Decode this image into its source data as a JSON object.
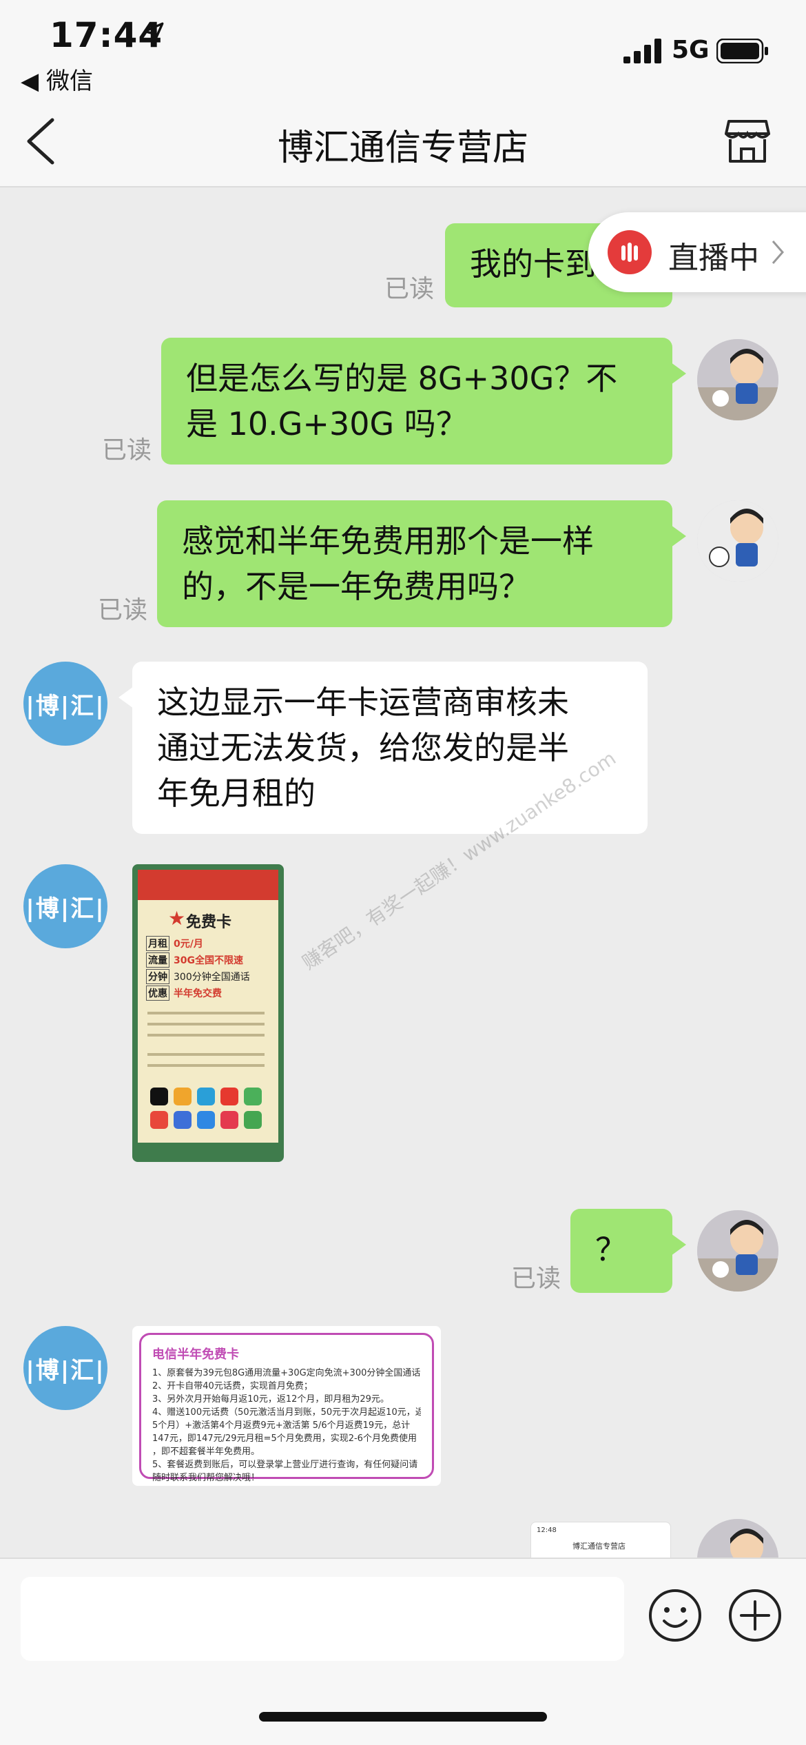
{
  "status_bar": {
    "time": "17:44",
    "back_app": "◀ 微信",
    "network": "5G"
  },
  "nav": {
    "title": "博汇通信专营店"
  },
  "live": {
    "label": "直播中"
  },
  "messages": [
    {
      "from": "me",
      "text": "我的卡到",
      "status": "已读"
    },
    {
      "from": "me",
      "lines": [
        "但是怎么写的是 8G+30G？不",
        "是 10.G+30G 吗？"
      ],
      "status": "已读"
    },
    {
      "from": "me",
      "lines": [
        "感觉和半年免费用那个是一样",
        "的，不是一年免费用吗？"
      ],
      "status": "已读"
    },
    {
      "from": "shop",
      "lines": [
        "这边显示一年卡运营商审核未",
        "通过无法发货，给您发的是半",
        "年免月租的"
      ]
    },
    {
      "from": "me",
      "text": "？",
      "status": "已读"
    }
  ],
  "shop_avatar": "|博|汇|",
  "poster": {
    "title": "免费卡",
    "rows": [
      {
        "k": "月租",
        "v": "0元/月"
      },
      {
        "k": "流量",
        "v": "30G全国不限速"
      },
      {
        "k": "分钟",
        "v": "300分钟全国通话"
      },
      {
        "k": "优惠",
        "v": "半年免交费"
      }
    ]
  },
  "note": {
    "title": "电信半年免费卡",
    "lines": [
      "1、原套餐为39元包8G通用流量+30G定向免流+300分钟全国通话；",
      "2、开卡自带40元话费，实现首月免费；",
      "3、另外次月开始每月返10元，返12个月，即月租为29元。",
      "4、赠送100元话费（50元激活当月到账，50元于次月起返10元，返",
      "   5个月）+激活第4个月返费9元+激活第 5/6个月返费19元，总计",
      "   147元，即147元/29元月租=5个月免费用，实现2-6个月免费使用",
      "   ，即不超套餐半年免费用。",
      "5、套餐返费到账后，可以登录掌上营业厅进行查询，有任何疑问请",
      "   随时联系我们帮您解决哦！"
    ]
  },
  "screenshot_thumb": {
    "time": "12:48",
    "title": "博汇通信专营店"
  },
  "watermark": "赚客吧，有奖一起赚！www.zuanke8.com"
}
